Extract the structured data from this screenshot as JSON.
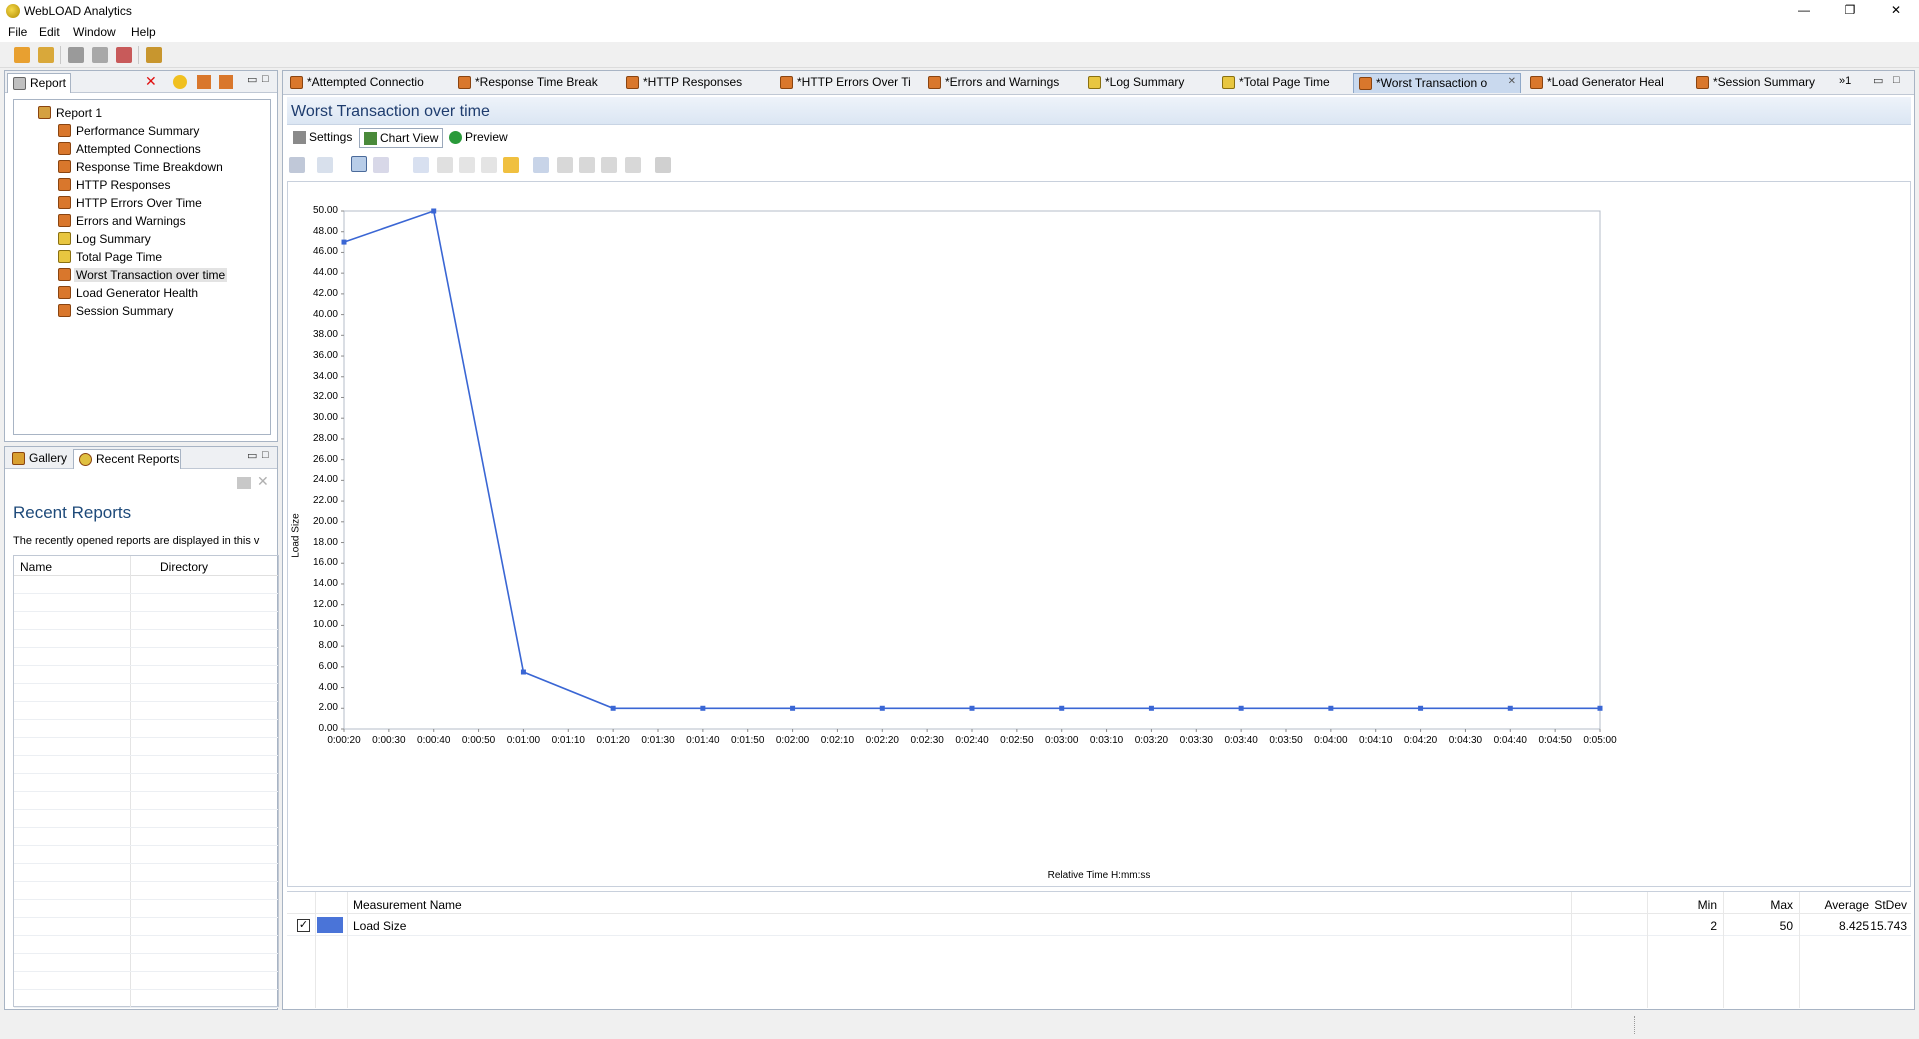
{
  "window": {
    "title": "WebLOAD Analytics",
    "minimize_glyph": "—",
    "maximize_glyph": "❐",
    "close_glyph": "✕"
  },
  "menu": [
    "File",
    "Edit",
    "Window",
    "Help"
  ],
  "report_panel": {
    "tab_label": "Report",
    "tree_root": "Report 1",
    "items": [
      {
        "label": "Performance Summary",
        "icon": "report-icon"
      },
      {
        "label": "Attempted Connections",
        "icon": "report-icon"
      },
      {
        "label": "Response Time Breakdown",
        "icon": "report-icon"
      },
      {
        "label": "HTTP Responses",
        "icon": "report-icon"
      },
      {
        "label": "HTTP Errors Over Time",
        "icon": "report-icon"
      },
      {
        "label": "Errors and Warnings",
        "icon": "report-icon"
      },
      {
        "label": "Log Summary",
        "icon": "report-warning-icon"
      },
      {
        "label": "Total Page Time",
        "icon": "report-warning-icon"
      },
      {
        "label": "Worst Transaction over time",
        "icon": "report-icon",
        "selected": true
      },
      {
        "label": "Load Generator Health",
        "icon": "report-icon"
      },
      {
        "label": "Session Summary",
        "icon": "report-icon"
      }
    ]
  },
  "gallery_panel": {
    "tabs": [
      "Gallery",
      "Recent Reports"
    ],
    "heading": "Recent Reports",
    "description": "The recently opened reports are displayed in this v",
    "columns": [
      "Name",
      "Directory"
    ]
  },
  "editor_tabs": {
    "tabs": [
      "*Attempted Connectio",
      "*Response Time Break",
      "*HTTP Responses",
      "*HTTP Errors Over Ti",
      "*Errors and Warnings",
      "*Log Summary",
      "*Total Page Time",
      "*Worst Transaction o",
      "*Load Generator Heal",
      "*Session Summary"
    ],
    "overflow": "»1",
    "close_glyph": "✕"
  },
  "editor": {
    "title": "Worst Transaction over time",
    "subtabs": [
      "Settings",
      "Chart View",
      "Preview"
    ]
  },
  "chart_data": {
    "type": "line",
    "xlabel": "Relative Time H:mm:ss",
    "ylabel": "Load Size",
    "ylim": [
      0,
      50
    ],
    "yticks": [
      "0.00",
      "2.00",
      "4.00",
      "6.00",
      "8.00",
      "10.00",
      "12.00",
      "14.00",
      "16.00",
      "18.00",
      "20.00",
      "22.00",
      "24.00",
      "26.00",
      "28.00",
      "30.00",
      "32.00",
      "34.00",
      "36.00",
      "38.00",
      "40.00",
      "42.00",
      "44.00",
      "46.00",
      "48.00",
      "50.00"
    ],
    "xticks": [
      "0:00:20",
      "0:00:30",
      "0:00:40",
      "0:00:50",
      "0:01:00",
      "0:01:10",
      "0:01:20",
      "0:01:30",
      "0:01:40",
      "0:01:50",
      "0:02:00",
      "0:02:10",
      "0:02:20",
      "0:02:30",
      "0:02:40",
      "0:02:50",
      "0:03:00",
      "0:03:10",
      "0:03:20",
      "0:03:30",
      "0:03:40",
      "0:03:50",
      "0:04:00",
      "0:04:10",
      "0:04:20",
      "0:04:30",
      "0:04:40",
      "0:04:50",
      "0:05:00"
    ],
    "series": [
      {
        "name": "Load Size",
        "color": "#3a66d4",
        "x": [
          "0:00:20",
          "0:00:40",
          "0:01:00",
          "0:01:20",
          "0:01:40",
          "0:02:00",
          "0:02:20",
          "0:02:40",
          "0:03:00",
          "0:03:20",
          "0:03:40",
          "0:04:00",
          "0:04:20",
          "0:04:40",
          "0:05:00"
        ],
        "values": [
          47,
          50,
          5.5,
          2,
          2,
          2,
          2,
          2,
          2,
          2,
          2,
          2,
          2,
          2,
          2
        ]
      }
    ],
    "grid": false
  },
  "stats_table": {
    "columns": [
      "Measurement Name",
      "Min",
      "Max",
      "Average",
      "StDev"
    ],
    "rows": [
      {
        "checked": true,
        "color": "#4a74d8",
        "name": "Load Size",
        "min": "2",
        "max": "50",
        "average": "8.425",
        "stdev": "15.743"
      }
    ]
  }
}
